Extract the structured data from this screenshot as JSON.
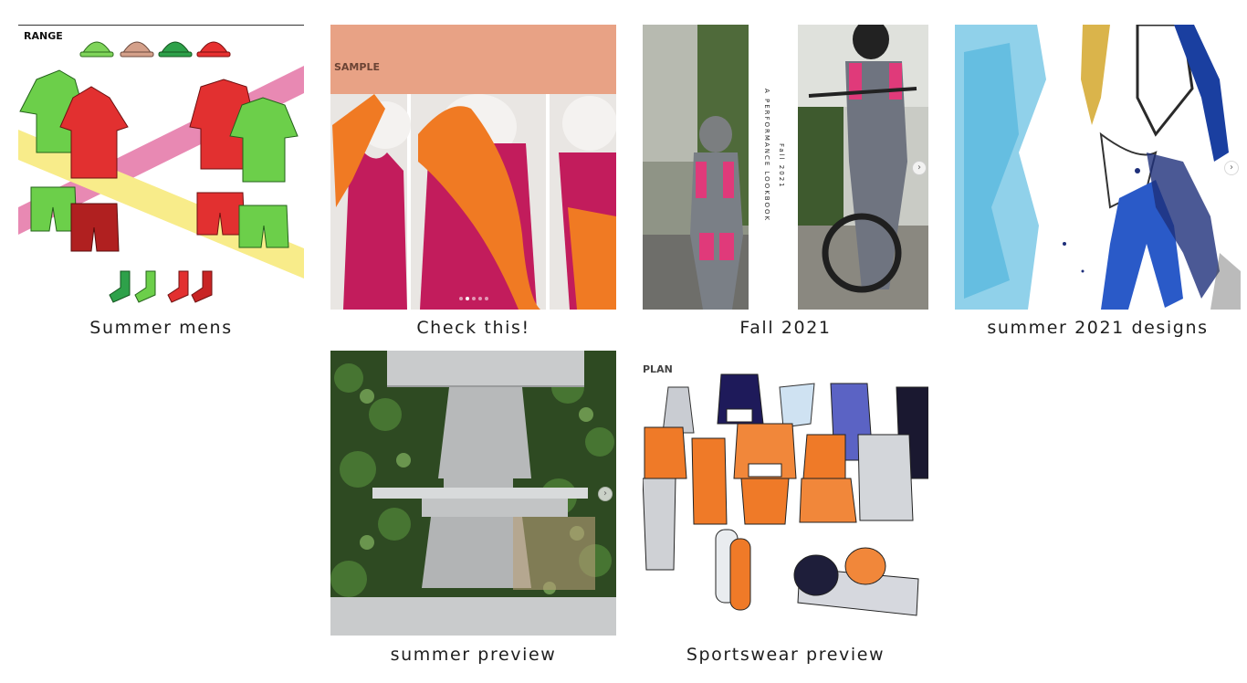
{
  "gallery": {
    "items": [
      {
        "caption": "Summer mens",
        "overlay_text": "RANGE"
      },
      {
        "caption": "Check this!",
        "overlay_text": "SAMPLE"
      },
      {
        "caption": "Fall 2021",
        "overlay_text": "A PERFORMANCE LOOKBOOK",
        "overlay_text_2": "Fall 2021"
      },
      {
        "caption": "summer 2021 designs"
      },
      {
        "caption": "summer preview"
      },
      {
        "caption": "Sportswear preview",
        "overlay_text": "PLAN"
      }
    ]
  },
  "icons": {
    "next": "chevron-right-icon"
  },
  "colors": {
    "caption_text": "#1e1e1e",
    "background": "#ffffff",
    "sample_banner": "#e8a285"
  }
}
